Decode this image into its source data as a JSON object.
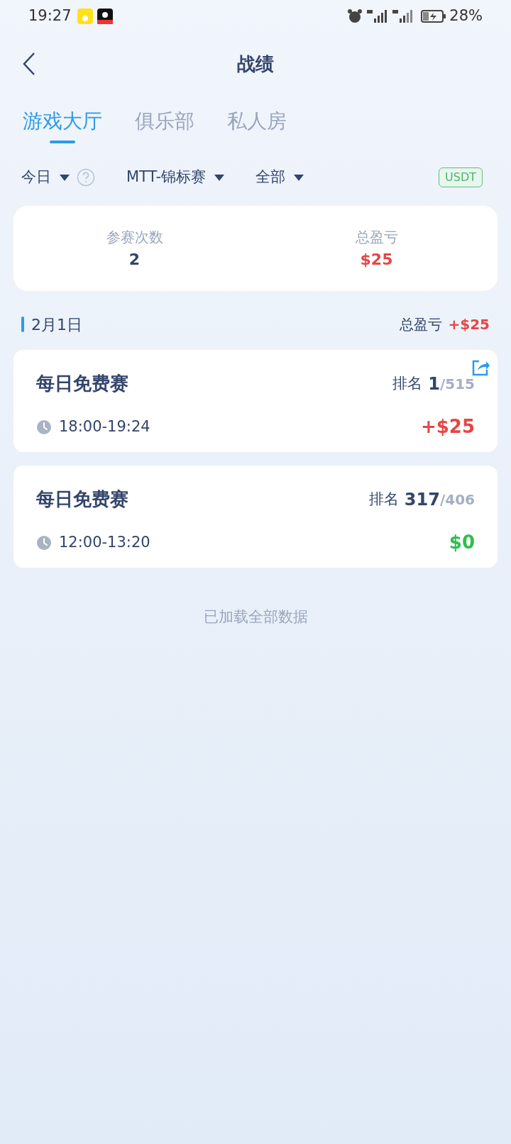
{
  "status_bar": {
    "time": "19:27",
    "battery": "28%"
  },
  "header": {
    "title": "战绩"
  },
  "tabs": [
    {
      "label": "游戏大厅",
      "selected": true
    },
    {
      "label": "俱乐部",
      "selected": false
    },
    {
      "label": "私人房",
      "selected": false
    }
  ],
  "filters": [
    {
      "label": "今日",
      "help": true
    },
    {
      "label": "MTT-锦标赛",
      "help": false
    },
    {
      "label": "全部",
      "help": false
    }
  ],
  "currency_badge": "USDT",
  "summary": [
    {
      "label": "参赛次数",
      "value": "2",
      "color": "#33456b"
    },
    {
      "label": "总盈亏",
      "value": "$25",
      "color": "#e84545"
    }
  ],
  "day": {
    "date": "2月1日",
    "total_label": "总盈亏",
    "total_value": "+$25"
  },
  "games": [
    {
      "name": "每日免费赛",
      "rank_label": "排名",
      "rank": "1",
      "field": "/515",
      "time": "18:00-19:24",
      "result": "+$25",
      "color": "#e84545",
      "shareable": true
    },
    {
      "name": "每日免费赛",
      "rank_label": "排名",
      "rank": "317",
      "field": "/406",
      "time": "12:00-13:20",
      "result": "$0",
      "color": "#2fbf4f",
      "shareable": false
    }
  ],
  "footer": "已加载全部数据"
}
